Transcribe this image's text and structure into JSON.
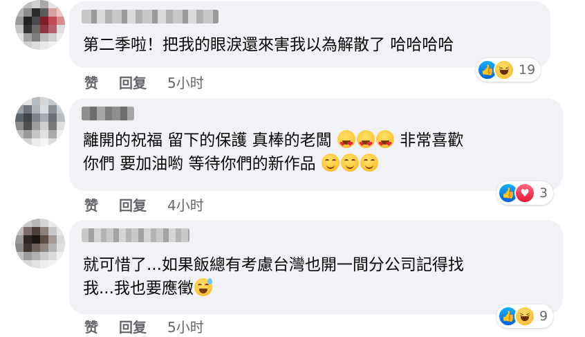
{
  "comments": [
    {
      "text": "第二季啦！把我的眼淚還來害我以為解散了 哈哈哈哈",
      "actions": {
        "like": "赞",
        "reply": "回复",
        "time": "5小时"
      },
      "reactions": {
        "icons": [
          "like-icon",
          "haha-icon"
        ],
        "count": "19"
      }
    },
    {
      "text_line1": "離開的祝福 留下的保護 真棒的老闆 ",
      "text_line1_tail": " 非常喜歡",
      "text_line2": "你們 要加油喲 等待你們的新作品 ",
      "emoji_line1": [
        "heart-eyes-emoji",
        "heart-eyes-emoji",
        "heart-eyes-emoji"
      ],
      "emoji_line2": [
        "smiling-emoji",
        "smiling-emoji",
        "smiling-emoji"
      ],
      "actions": {
        "like": "赞",
        "reply": "回复",
        "time": "4小时"
      },
      "reactions": {
        "icons": [
          "like-icon",
          "love-icon"
        ],
        "count": "3"
      }
    },
    {
      "text_line1": "就可惜了...如果飯總有考慮台灣也開一間分公司記得找",
      "text_line2": "我...我也要應徵",
      "emoji_line2": [
        "grinning-sweat-emoji"
      ],
      "actions": {
        "like": "赞",
        "reply": "回复",
        "time": "5小时"
      },
      "reactions": {
        "icons": [
          "like-icon",
          "haha-icon"
        ],
        "count": "9"
      }
    }
  ],
  "colors": {
    "bubble": "#f0f2f5",
    "meta_text": "#65676b",
    "like": "#1877f2",
    "love": "#f33e58",
    "haha": "#f7b125"
  }
}
